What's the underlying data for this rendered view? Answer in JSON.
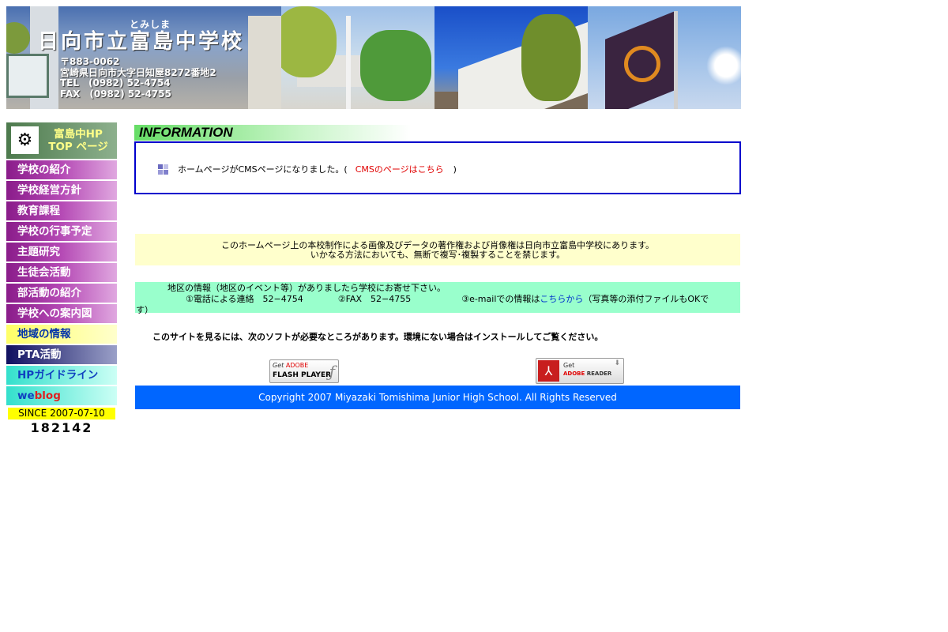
{
  "header": {
    "ruby": "とみしま",
    "school_name": "日向市立富島中学校",
    "postal": "〒883-0062",
    "address": "宮崎県日向市大字日知屋8272番地2",
    "tel": "TEL　(0982) 52-4754",
    "fax": "FAX　(0982) 52-4755"
  },
  "sidebar": {
    "top_button": {
      "line1": "富島中HP",
      "line2": "TOP ページ",
      "logo_icon": "school-emblem"
    },
    "items": [
      {
        "label": "学校の紹介",
        "style": "purple"
      },
      {
        "label": "学校経営方針",
        "style": "purple"
      },
      {
        "label": "教育課程",
        "style": "purple"
      },
      {
        "label": "学校の行事予定",
        "style": "purple"
      },
      {
        "label": "主題研究",
        "style": "purple"
      },
      {
        "label": "生徒会活動",
        "style": "purple"
      },
      {
        "label": "部活動の紹介",
        "style": "purple"
      },
      {
        "label": "学校への案内図",
        "style": "purple"
      },
      {
        "label": "地域の情報",
        "style": "yellow"
      },
      {
        "label": "PTA活動",
        "style": "navy"
      },
      {
        "label": "HPガイドライン",
        "style": "cyan"
      }
    ],
    "weblog": {
      "part1": "we",
      "part2": "blog"
    },
    "since": "SINCE 2007-07-10",
    "counter": "182142"
  },
  "information": {
    "heading": "INFORMATION",
    "message": "ホームページがCMSページになりました。(",
    "link": "CMSのページはこちら",
    "close_paren": ")",
    "bullet_icon": "grid-bullet"
  },
  "notice": {
    "line1": "このホームページ上の本校制作による画像及びデータの著作権および肖像権は日向市立富島中学校にあります。",
    "line2": "いかなる方法においても、無断で複写･複製することを禁じます。"
  },
  "region_info": {
    "line1": "地区の情報（地区のイベント等）がありましたら学校にお寄せ下さい。",
    "phone": "①電話による連絡　52−4754",
    "fax": "②FAX　52−4755",
    "email_prefix": "③e-mailでの情報は",
    "email_link": "こちらから",
    "email_suffix": "（写真等の添付ファイルもOKで",
    "wrap": "す）"
  },
  "software_notice": "このサイトを見るには、次のソフトが必要なところがあります。環境にない場合はインストールしてご覧ください。",
  "flash_button": {
    "get": "Get",
    "brand": "ADOBE",
    "name": "FLASH PLAYER"
  },
  "reader_button": {
    "get": "Get",
    "brand": "ADOBE",
    "name": "READER"
  },
  "footer": "Copyright 2007 Miyazaki Tomishima Junior High School. All Rights Reserved",
  "colors": {
    "nav_purple": "#8a1c8a",
    "info_border": "#0000cc",
    "notice_bg": "#ffffcc",
    "region_bg": "#99ffcc",
    "footer_bg": "#0066ff",
    "link_red": "#e00000",
    "link_blue": "#0033cc"
  }
}
